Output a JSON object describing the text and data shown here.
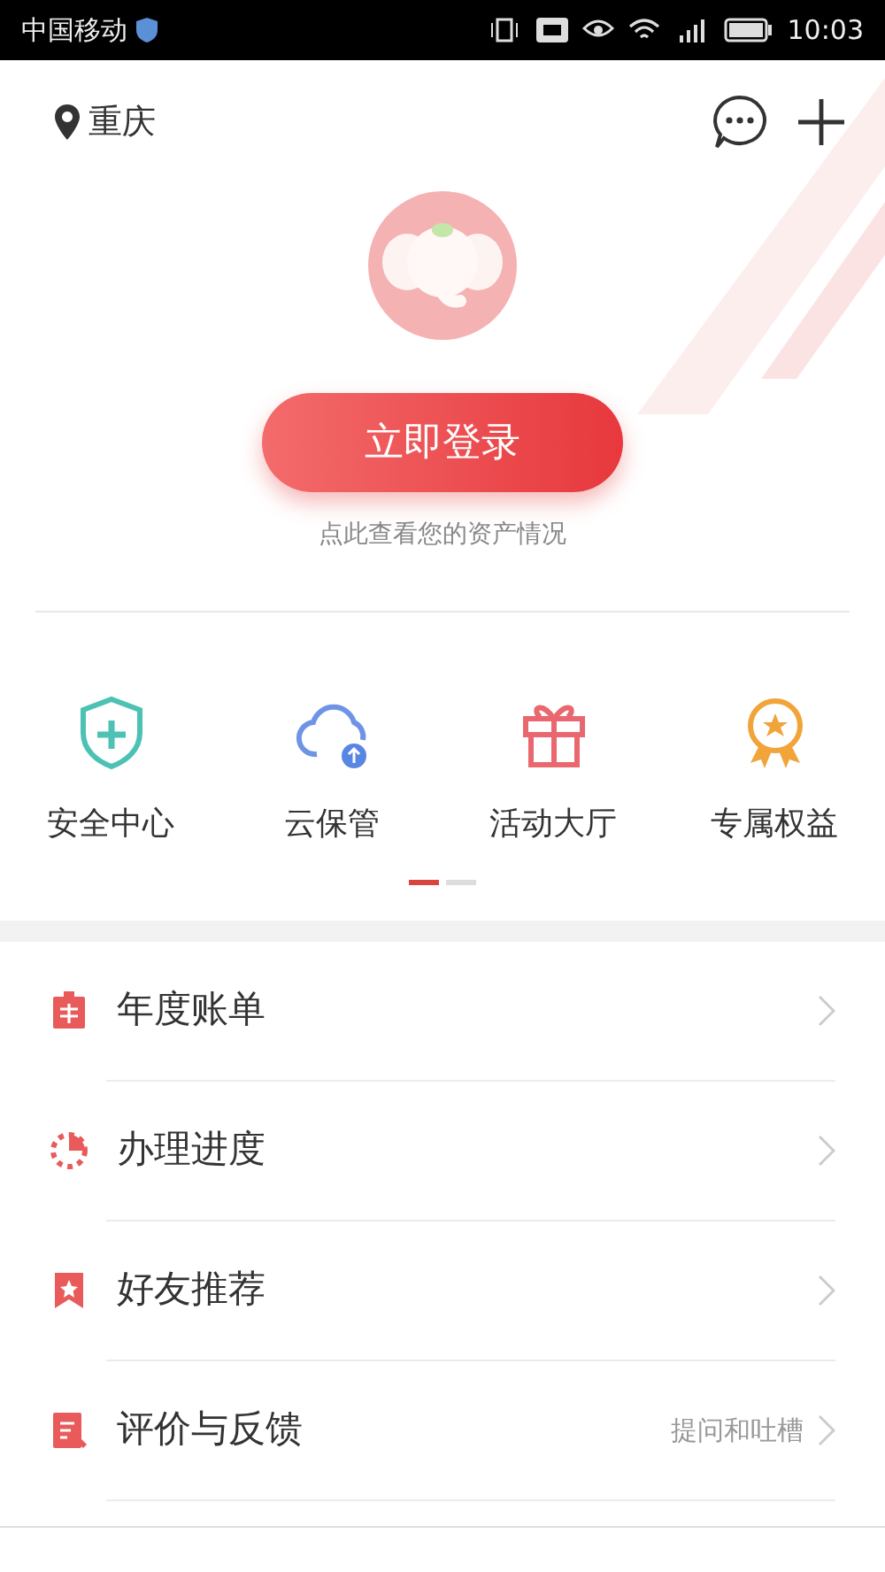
{
  "status_bar": {
    "carrier": "中国移动",
    "time": "10:03"
  },
  "location": "重庆",
  "login_button": "立即登录",
  "login_hint": "点此查看您的资产情况",
  "shortcuts": [
    {
      "label": "安全中心"
    },
    {
      "label": "云保管"
    },
    {
      "label": "活动大厅"
    },
    {
      "label": "专属权益"
    }
  ],
  "pager": [
    {
      "selected": true
    },
    {
      "selected": false
    }
  ],
  "menu": [
    {
      "label": "年度账单"
    },
    {
      "label": "办理进度"
    },
    {
      "label": "好友推荐"
    },
    {
      "label": "评价与反馈",
      "note": "提问和吐槽"
    }
  ]
}
